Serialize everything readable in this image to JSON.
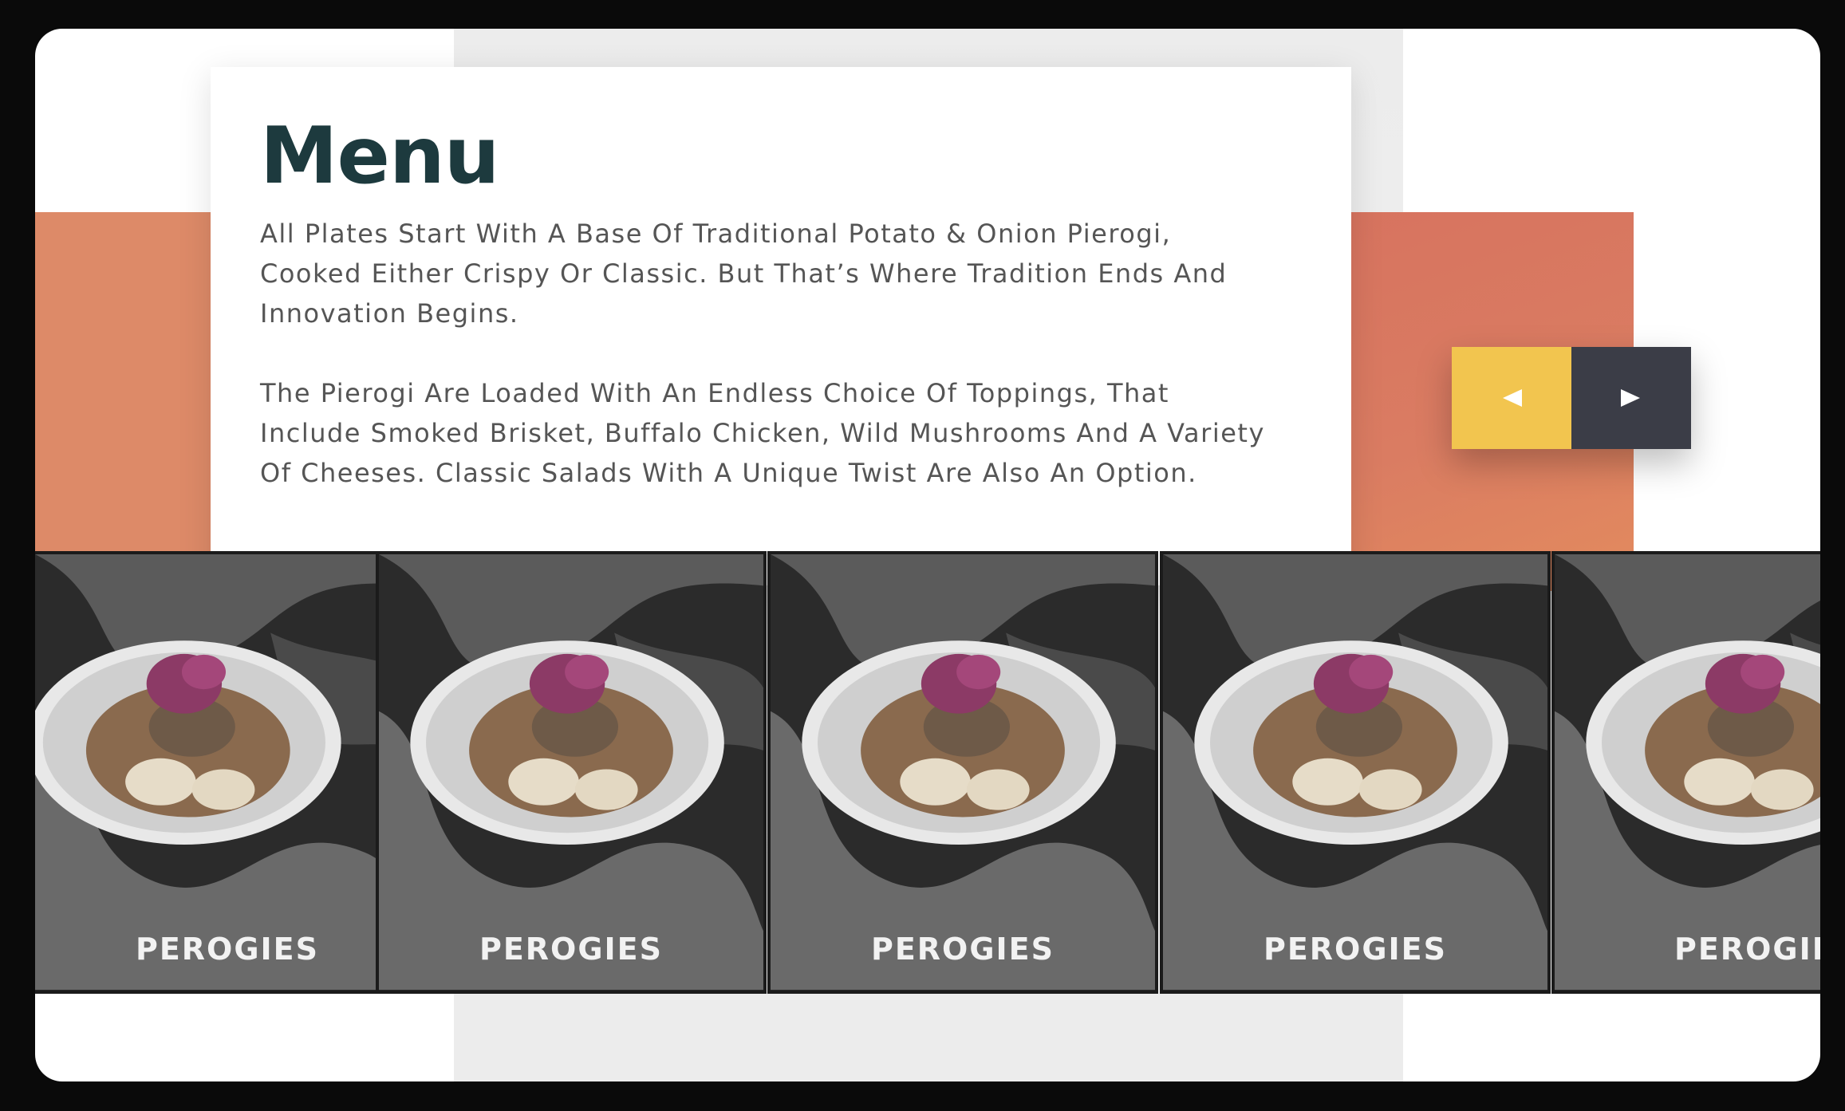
{
  "menu": {
    "title": "Menu",
    "paragraph1": "All Plates Start With A Base Of Traditional Potato & Onion Pierogi, Cooked Either Crispy Or Classic. But That’s Where Tradition Ends And Innovation Begins.",
    "paragraph2": "The Pierogi Are Loaded With An Endless Choice Of Toppings, That Include Smoked Brisket, Buffalo Chicken, Wild Mushrooms And A Variety Of Cheeses. Classic Salads With A Unique Twist Are Also An Option."
  },
  "nav": {
    "prev_icon": "triangle-left-icon",
    "next_icon": "triangle-right-icon"
  },
  "carousel": {
    "items": [
      {
        "label": "PEROGIES"
      },
      {
        "label": "PEROGIES"
      },
      {
        "label": "PEROGIES"
      },
      {
        "label": "PEROGIES"
      },
      {
        "label": "PEROGIE"
      }
    ]
  },
  "colors": {
    "accent_orange": "#dd8a68",
    "prev_button": "#f2c54f",
    "next_button": "#3b3d47",
    "title": "#1d3a3e"
  }
}
